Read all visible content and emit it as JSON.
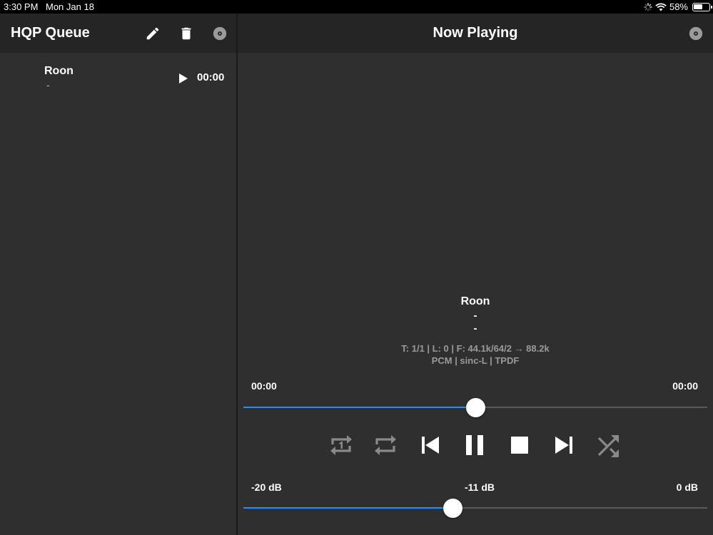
{
  "status_bar": {
    "time": "3:30 PM",
    "date": "Mon Jan 18",
    "battery_text": "58%",
    "battery_level": 0.58,
    "icons": [
      "activity-spinner-icon",
      "wifi-icon",
      "battery-icon"
    ]
  },
  "left": {
    "title": "HQP Queue",
    "header_icons": [
      "pencil-icon",
      "trash-icon",
      "disc-icon"
    ],
    "queue": [
      {
        "title": "Roon",
        "subtitle": "-",
        "duration": "00:00"
      }
    ]
  },
  "right": {
    "title": "Now Playing",
    "header_icon": "disc-icon",
    "now_playing": {
      "title": "Roon",
      "line1": "-",
      "line2": "-",
      "info1": "T: 1/1 | L: 0 | F: 44.1k/64/2 → 88.2k",
      "info2": "PCM | sinc-L | TPDF"
    },
    "progress": {
      "elapsed": "00:00",
      "remaining": "00:00",
      "position": 0.5
    },
    "controls": [
      "repeat-one-icon",
      "repeat-icon",
      "previous-icon",
      "pause-icon",
      "stop-icon",
      "next-icon",
      "shuffle-icon"
    ],
    "volume": {
      "min_label": "-20 dB",
      "current_label": "-11 dB",
      "max_label": "0 dB",
      "level": 0.45
    }
  },
  "colors": {
    "accent": "#1e90ff",
    "background": "#2f2f2f",
    "header": "#252525",
    "muted_text": "#9a9a9a",
    "disabled_icon": "#8a8a8a"
  }
}
